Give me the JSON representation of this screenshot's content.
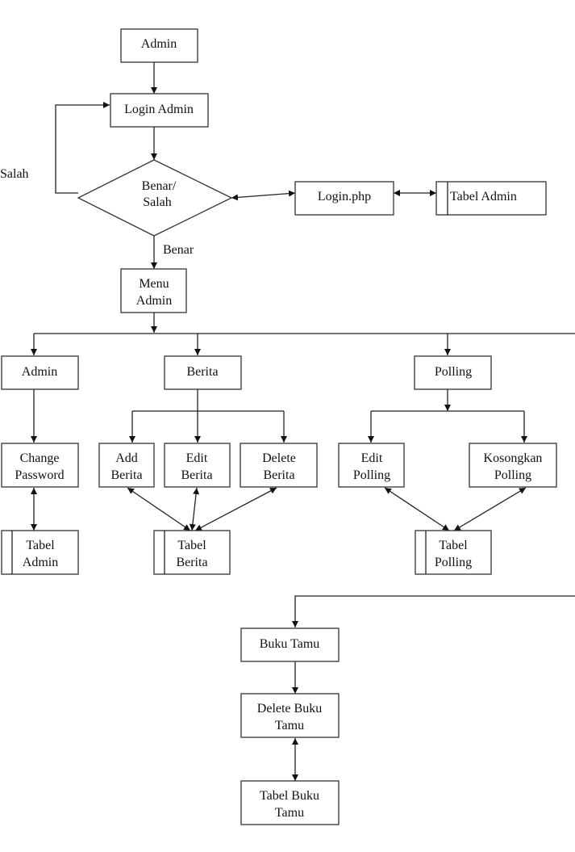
{
  "diagram": {
    "type": "flowchart",
    "nodes": {
      "admin_start": {
        "lines": [
          "Admin"
        ],
        "shape": "process"
      },
      "login_admin": {
        "lines": [
          "Login Admin"
        ],
        "shape": "process"
      },
      "decision": {
        "lines": [
          "Benar/",
          "Salah"
        ],
        "shape": "decision"
      },
      "login_php": {
        "lines": [
          "Login.php"
        ],
        "shape": "process"
      },
      "tabel_admin_top": {
        "lines": [
          "Tabel Admin"
        ],
        "shape": "datastore"
      },
      "menu_admin": {
        "lines": [
          "Menu",
          "Admin"
        ],
        "shape": "process"
      },
      "admin_menu": {
        "lines": [
          "Admin"
        ],
        "shape": "process"
      },
      "berita": {
        "lines": [
          "Berita"
        ],
        "shape": "process"
      },
      "polling": {
        "lines": [
          "Polling"
        ],
        "shape": "process"
      },
      "change_password": {
        "lines": [
          "Change",
          "Password"
        ],
        "shape": "process"
      },
      "tabel_admin": {
        "lines": [
          "Tabel",
          "Admin"
        ],
        "shape": "datastore"
      },
      "add_berita": {
        "lines": [
          "Add",
          "Berita"
        ],
        "shape": "process"
      },
      "edit_berita": {
        "lines": [
          "Edit",
          "Berita"
        ],
        "shape": "process"
      },
      "delete_berita": {
        "lines": [
          "Delete",
          "Berita"
        ],
        "shape": "process"
      },
      "tabel_berita": {
        "lines": [
          "Tabel",
          "Berita"
        ],
        "shape": "datastore"
      },
      "edit_polling": {
        "lines": [
          "Edit",
          "Polling"
        ],
        "shape": "process"
      },
      "kosongkan_polling": {
        "lines": [
          "Kosongkan",
          "Polling"
        ],
        "shape": "process"
      },
      "tabel_polling": {
        "lines": [
          "Tabel",
          "Polling"
        ],
        "shape": "datastore"
      },
      "buku_tamu": {
        "lines": [
          "Buku Tamu"
        ],
        "shape": "process"
      },
      "delete_buku_tamu": {
        "lines": [
          "Delete Buku",
          "Tamu"
        ],
        "shape": "process"
      },
      "tabel_buku_tamu": {
        "lines": [
          "Tabel Buku",
          "Tamu"
        ],
        "shape": "process"
      }
    },
    "edge_labels": {
      "salah": "Salah",
      "benar": "Benar"
    },
    "edges": [
      {
        "from": "admin_start",
        "to": "login_admin",
        "direction": "forward"
      },
      {
        "from": "login_admin",
        "to": "decision",
        "direction": "forward"
      },
      {
        "from": "decision",
        "to": "login_admin",
        "direction": "forward",
        "label": "Salah"
      },
      {
        "from": "decision",
        "to": "login_php",
        "direction": "both"
      },
      {
        "from": "login_php",
        "to": "tabel_admin_top",
        "direction": "both"
      },
      {
        "from": "decision",
        "to": "menu_admin",
        "direction": "forward",
        "label": "Benar"
      },
      {
        "from": "menu_admin",
        "to": "admin_menu",
        "direction": "forward"
      },
      {
        "from": "menu_admin",
        "to": "berita",
        "direction": "forward"
      },
      {
        "from": "menu_admin",
        "to": "polling",
        "direction": "forward"
      },
      {
        "from": "menu_admin",
        "to": "buku_tamu",
        "direction": "forward"
      },
      {
        "from": "admin_menu",
        "to": "change_password",
        "direction": "forward"
      },
      {
        "from": "change_password",
        "to": "tabel_admin",
        "direction": "both"
      },
      {
        "from": "berita",
        "to": "add_berita",
        "direction": "forward"
      },
      {
        "from": "berita",
        "to": "edit_berita",
        "direction": "forward"
      },
      {
        "from": "berita",
        "to": "delete_berita",
        "direction": "forward"
      },
      {
        "from": "add_berita",
        "to": "tabel_berita",
        "direction": "both"
      },
      {
        "from": "edit_berita",
        "to": "tabel_berita",
        "direction": "both"
      },
      {
        "from": "delete_berita",
        "to": "tabel_berita",
        "direction": "both"
      },
      {
        "from": "polling",
        "to": "edit_polling",
        "direction": "forward"
      },
      {
        "from": "polling",
        "to": "kosongkan_polling",
        "direction": "forward"
      },
      {
        "from": "edit_polling",
        "to": "tabel_polling",
        "direction": "both"
      },
      {
        "from": "kosongkan_polling",
        "to": "tabel_polling",
        "direction": "both"
      },
      {
        "from": "buku_tamu",
        "to": "delete_buku_tamu",
        "direction": "forward"
      },
      {
        "from": "delete_buku_tamu",
        "to": "tabel_buku_tamu",
        "direction": "both"
      }
    ]
  }
}
